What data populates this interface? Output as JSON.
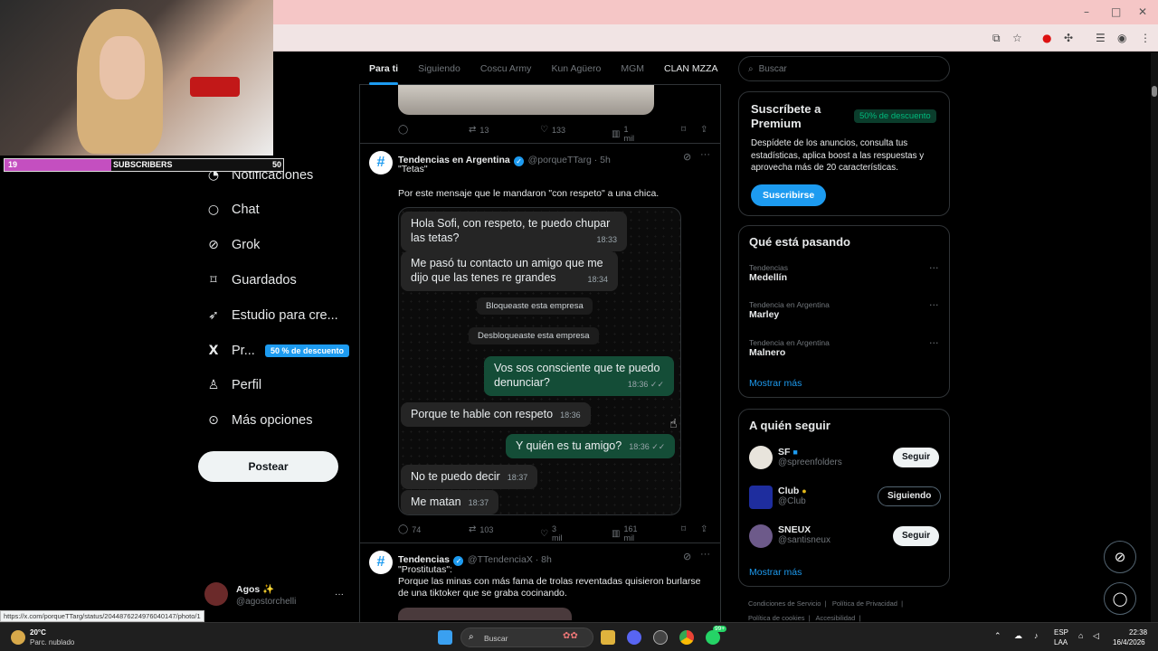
{
  "browser": {
    "window_buttons": [
      "–",
      "□",
      "✕"
    ],
    "toolbar_icons": [
      "install-icon",
      "star-icon",
      "extension-red-icon",
      "puzzle-icon",
      "menu-list-icon",
      "profile-icon",
      "more-icon"
    ]
  },
  "stream_overlay": {
    "subscribers_current": "19",
    "subscribers_label": "SUBSCRIBERS",
    "subscribers_goal": "50"
  },
  "sidebar": {
    "items": [
      {
        "label": "Notificaciones",
        "icon": "bell-icon",
        "glyph": "🔔"
      },
      {
        "label": "Chat",
        "icon": "chat-icon",
        "glyph": "○"
      },
      {
        "label": "Grok",
        "icon": "grok-icon",
        "glyph": "⊘"
      },
      {
        "label": "Guardados",
        "icon": "bookmark-icon",
        "glyph": "⌑"
      },
      {
        "label": "Estudio para cre...",
        "icon": "rocket-icon",
        "glyph": "➶"
      },
      {
        "label": "Pr...",
        "icon": "x-logo-icon",
        "glyph": "𝕏"
      },
      {
        "label": "Perfil",
        "icon": "person-icon",
        "glyph": "♙"
      },
      {
        "label": "Más opciones",
        "icon": "more-circle-icon",
        "glyph": "⊙"
      }
    ],
    "premium_badge": "50 % de descuento",
    "post_button": "Postear",
    "account_name": "Agos ✨",
    "account_handle": "@agostorchelli",
    "account_more": "···"
  },
  "tabs": [
    "Para ti",
    "Siguiendo",
    "Coscu Army",
    "Kun Agüero",
    "MGM",
    "CLAN MZZA"
  ],
  "tweet0_actions": {
    "replies": "",
    "retweets": "13",
    "likes": "133",
    "views": "1 mil"
  },
  "tweet1": {
    "name": "Tendencias en Argentina",
    "handle": "@porqueTTarg · 5h",
    "quote": "\"Tetas\"",
    "text": "Por este mensaje que le mandaron \"con respeto\" a una chica.",
    "actions": {
      "replies": "74",
      "retweets": "103",
      "likes": "3 mil",
      "views": "161 mil"
    }
  },
  "chat": {
    "m1": "Hola Sofi, con respeto, te puedo chupar las tetas?",
    "t1": "18:33",
    "m2": "Me pasó tu contacto un amigo que me dijo que las tenes re grandes",
    "t2": "18:34",
    "sys1": "Bloqueaste esta empresa",
    "sys2": "Desbloqueaste esta empresa",
    "m3": "Vos sos consciente que te puedo denunciar?",
    "t3": "18:36 ✓✓",
    "m4": "Porque te hable con respeto",
    "t4": "18:36",
    "m5": "Y quién es tu amigo?",
    "t5": "18:36 ✓✓",
    "m6": "No te puedo decir",
    "t6": "18:37",
    "m7": "Me matan",
    "t7": "18:37"
  },
  "tweet2": {
    "name": "Tendencias",
    "handle": "@TTendenciaX · 8h",
    "quote": "\"Prostitutas\":",
    "text": "Porque las minas con más fama de trolas reventadas quisieron burlarse de una tiktoker que se graba cocinando."
  },
  "right": {
    "search_placeholder": "Buscar",
    "premium": {
      "title": "Suscríbete a Premium",
      "discount": "50% de descuento",
      "body": "Despídete de los anuncios, consulta tus estadísticas, aplica boost a las respuestas y aprovecha más de 20 características.",
      "button": "Suscribirse"
    },
    "trends": {
      "title": "Qué está pasando",
      "items": [
        {
          "context": "Tendencias",
          "name": "Medellín"
        },
        {
          "context": "Tendencia en Argentina",
          "name": "Marley"
        },
        {
          "context": "Tendencia en Argentina",
          "name": "Malnero"
        }
      ],
      "show_more": "Mostrar más"
    },
    "follow": {
      "title": "A quién seguir",
      "items": [
        {
          "name": "SF",
          "handle": "@spreenfolders",
          "button": "Seguir"
        },
        {
          "name": "Club",
          "handle": "@Club",
          "button": "Siguiendo"
        },
        {
          "name": "SNEUX",
          "handle": "@santisneux",
          "button": "Seguir"
        }
      ],
      "show_more": "Mostrar más"
    },
    "footer": [
      "Condiciones de Servicio",
      "Política de Privacidad",
      "Política de cookies",
      "Accesibilidad"
    ]
  },
  "status_url": "https://x.com/porqueTTarg/status/2044876224976040147/photo/1",
  "taskbar": {
    "weather_temp": "20°C",
    "weather_desc": "Parc. nublado",
    "search_placeholder": "Buscar",
    "lang1": "ESP",
    "lang2": "LAA",
    "time": "22:38",
    "date": "16/4/2026",
    "badge": "99+"
  },
  "colors": {
    "accent": "#1d9bf0",
    "chat_out": "#144d37",
    "chat_in": "#252525",
    "title_bar": "#f5c6c6"
  }
}
